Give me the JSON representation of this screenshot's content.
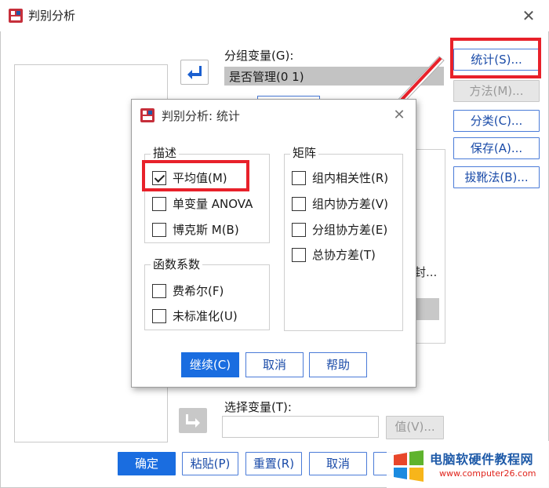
{
  "window": {
    "title": "判别分析",
    "close_symbol": "✕"
  },
  "main": {
    "grouping_variable_label": "分组变量(G):",
    "grouping_variable_value": "是否管理(0 1)",
    "selection_variable_label": "选择变量(T):",
    "selection_variable_value": "",
    "value_button": "值(V)...",
    "partial_hidden_text": "封..."
  },
  "side_buttons": {
    "statistics": "统计(S)...",
    "method": "方法(M)...",
    "classify": "分类(C)...",
    "save": "保存(A)...",
    "bootstrap": "拔靴法(B)..."
  },
  "bottom_buttons": {
    "ok": "确定",
    "paste": "粘贴(P)",
    "reset": "重置(R)",
    "cancel": "取消"
  },
  "sub_dialog": {
    "title": "判别分析: 统计",
    "close_symbol": "✕",
    "descriptives": {
      "title": "描述",
      "items": [
        {
          "label": "平均值(M)",
          "checked": true
        },
        {
          "label": "单变量 ANOVA",
          "checked": false
        },
        {
          "label": "博克斯 M(B)",
          "checked": false
        }
      ]
    },
    "function_coefficients": {
      "title": "函数系数",
      "items": [
        {
          "label": "费希尔(F)",
          "checked": false
        },
        {
          "label": "未标准化(U)",
          "checked": false
        }
      ]
    },
    "matrices": {
      "title": "矩阵",
      "items": [
        {
          "label": "组内相关性(R)",
          "checked": false
        },
        {
          "label": "组内协方差(V)",
          "checked": false
        },
        {
          "label": "分组协方差(E)",
          "checked": false
        },
        {
          "label": "总协方差(T)",
          "checked": false
        }
      ]
    },
    "buttons": {
      "continue": "继续(C)",
      "cancel": "取消",
      "help": "帮助"
    }
  },
  "watermark": {
    "name": "电脑软硬件教程网",
    "url": "www.computer26.com"
  },
  "colors": {
    "accent": "#1a6de0",
    "highlight": "#e8212a",
    "disabled": "#c8c8c8"
  }
}
